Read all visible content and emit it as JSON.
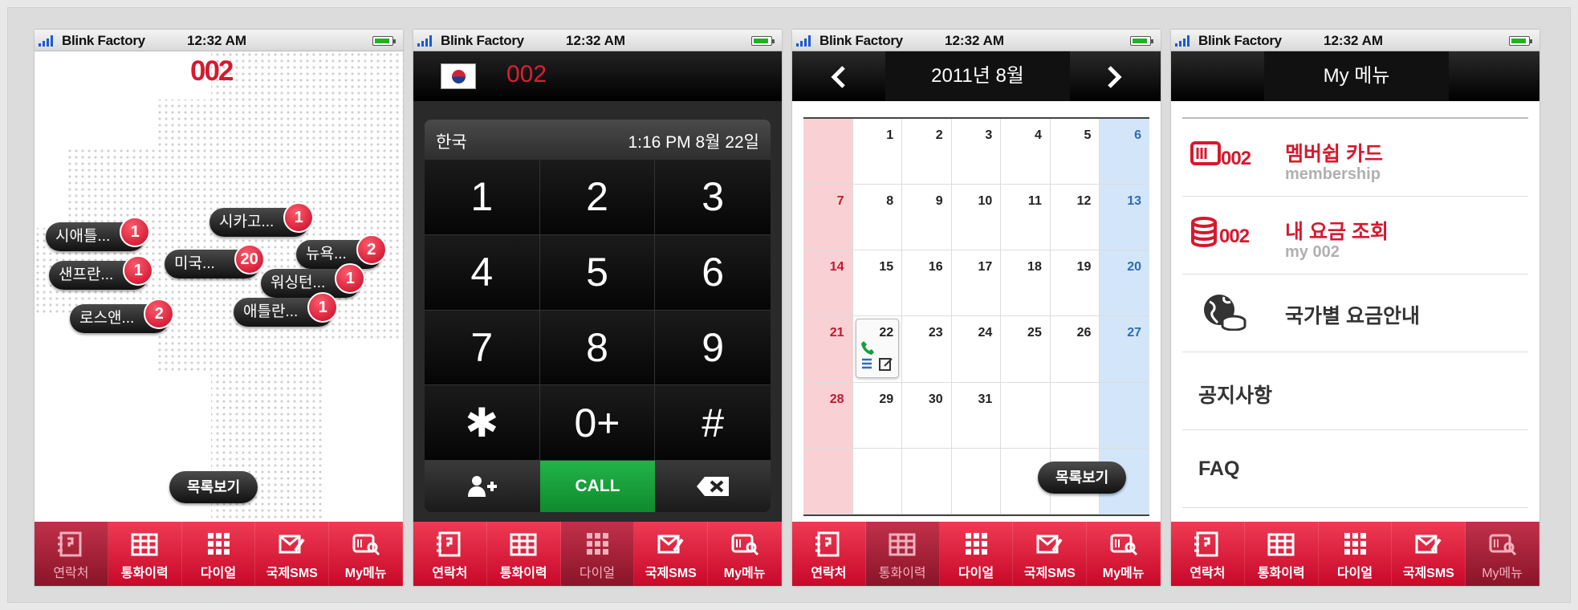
{
  "status": {
    "carrier": "Blink Factory",
    "time": "12:32 AM"
  },
  "tabs": [
    "연락처",
    "통화이력",
    "다이얼",
    "국제SMS",
    "My메뉴"
  ],
  "map_screen": {
    "logo": "002",
    "cities": [
      {
        "name": "시애틀...",
        "count": "1"
      },
      {
        "name": "시카고...",
        "count": "1"
      },
      {
        "name": "뉴욕...",
        "count": "2"
      },
      {
        "name": "미국...",
        "count": "20"
      },
      {
        "name": "샌프란...",
        "count": "1"
      },
      {
        "name": "워싱턴...",
        "count": "1"
      },
      {
        "name": "로스앤...",
        "count": "2"
      },
      {
        "name": "애틀란...",
        "count": "1"
      }
    ],
    "list_button": "목록보기"
  },
  "dial_screen": {
    "number": "002",
    "country": "한국",
    "datetime": "1:16 PM 8월 22일",
    "keys": [
      "1",
      "2",
      "3",
      "4",
      "5",
      "6",
      "7",
      "8",
      "9",
      "✱",
      "0+",
      "#"
    ],
    "call_label": "CALL"
  },
  "calendar_screen": {
    "title": "2011년 8월",
    "weeks": [
      [
        "",
        "1",
        "2",
        "3",
        "4",
        "5",
        "6"
      ],
      [
        "7",
        "8",
        "9",
        "10",
        "11",
        "12",
        "13"
      ],
      [
        "14",
        "15",
        "16",
        "17",
        "18",
        "19",
        "20"
      ],
      [
        "21",
        "22",
        "23",
        "24",
        "25",
        "26",
        "27"
      ],
      [
        "28",
        "29",
        "30",
        "31",
        "",
        "",
        ""
      ],
      [
        "",
        "",
        "",
        "",
        "",
        "",
        ""
      ]
    ],
    "list_button": "목록보기"
  },
  "my_menu_screen": {
    "title": "My 메뉴",
    "items": [
      {
        "title": "멤버쉽 카드",
        "subtitle": "membership",
        "icon": "membership-card-icon",
        "icon_text": "002"
      },
      {
        "title": "내 요금 조회",
        "subtitle": "my 002",
        "icon": "billing-coins-icon",
        "icon_text": "002"
      },
      {
        "title": "국가별 요금안내",
        "subtitle": "",
        "icon": "globe-coins-icon"
      },
      {
        "title": "공지사항"
      },
      {
        "title": "FAQ"
      }
    ]
  },
  "colors": {
    "brand_red": "#d6192e",
    "call_green": "#1a9c3c",
    "sunday_bg": "#f9d1d4",
    "saturday_bg": "#d3e6f9"
  }
}
